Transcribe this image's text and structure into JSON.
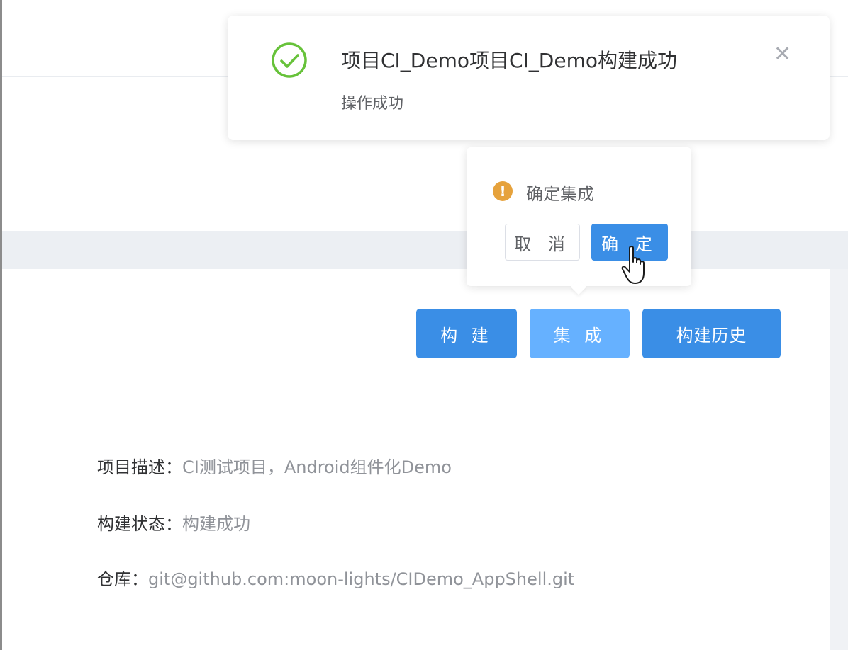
{
  "notification": {
    "title": "项目CI_Demo项目CI_Demo构建成功",
    "message": "操作成功",
    "icon": "success-check-icon",
    "close_icon": "close-icon",
    "color": "#67c23a"
  },
  "popconfirm": {
    "message": "确定集成",
    "icon": "warning-icon",
    "cancel_label": "取 消",
    "confirm_label": "确 定"
  },
  "toolbar": {
    "build_label": "构 建",
    "integrate_label": "集 成",
    "history_label": "构建历史"
  },
  "project": {
    "description_label": "项目描述：",
    "description_value": "CI测试项目，Android组件化Demo",
    "status_label": "构建状态：",
    "status_value": "构建成功",
    "repo_label": "仓库：",
    "repo_value": "git@github.com:moon-lights/CIDemo_AppShell.git"
  },
  "colors": {
    "primary": "#3a8ee6",
    "primary_light": "#66b1ff",
    "warning": "#e6a23c",
    "success": "#67c23a"
  }
}
